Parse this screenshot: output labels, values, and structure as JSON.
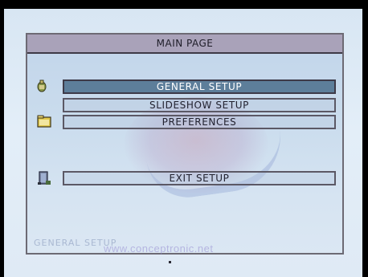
{
  "header": {
    "title": "MAIN PAGE"
  },
  "menu": {
    "items": [
      {
        "label": "GENERAL SETUP",
        "selected": true
      },
      {
        "label": "SLIDESHOW SETUP",
        "selected": false
      },
      {
        "label": "PREFERENCES",
        "selected": false
      },
      {
        "label": "EXIT SETUP",
        "selected": false
      }
    ]
  },
  "icons": {
    "general": "settings-figure-icon",
    "preferences": "folder-icon",
    "exit": "exit-door-icon"
  },
  "footer": {
    "status": "GENERAL SETUP",
    "watermark": "www.conceptronic.net"
  },
  "colors": {
    "title_bar": "#a9a2b9",
    "selected_row": "#5d7e9a",
    "panel_bg": "#c8dbee"
  }
}
